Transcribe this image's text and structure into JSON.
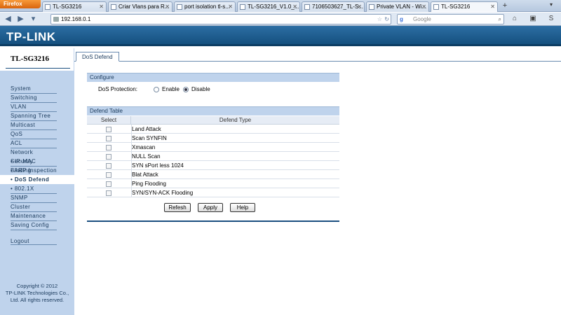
{
  "browser": {
    "app_button": "Firefox",
    "tabs": [
      {
        "title": "TL-SG3216"
      },
      {
        "title": "Criar Vlans para R..."
      },
      {
        "title": "port isolation tl-s..."
      },
      {
        "title": "TL-SG3216_V1.0_..."
      },
      {
        "title": "7106503627_TL-S..."
      },
      {
        "title": "Private VLAN - Wi..."
      },
      {
        "title": "TL-SG3216"
      }
    ],
    "url": "192.168.0.1",
    "search_engine": "Google",
    "search_placeholder": "Google"
  },
  "header": {
    "logo": "TP-LINK"
  },
  "sidebar": {
    "model": "TL-SG3216",
    "menu": [
      "System",
      "Switching",
      "VLAN",
      "Spanning Tree",
      "Multicast",
      "QoS",
      "ACL",
      "Network Security",
      "• IP-MAC Binding",
      "• ARP Inspection",
      "• DoS Defend",
      "• 802.1X",
      "SNMP",
      "Cluster",
      "Maintenance",
      "Saving Config"
    ],
    "active_item": "• DoS Defend",
    "logout": "Logout",
    "copyright": [
      "Copyright © 2012",
      "TP-LINK Technologies Co.,",
      "Ltd. All rights reserved."
    ]
  },
  "page": {
    "tab": "DoS Defend",
    "configure": {
      "title": "Configure",
      "label": "DoS Protection:",
      "options": [
        "Enable",
        "Disable"
      ],
      "selected": "Disable"
    },
    "defend_table": {
      "title": "Defend Table",
      "columns": [
        "Select",
        "Defend Type"
      ],
      "rows": [
        "Land Attack",
        "Scan SYNFIN",
        "Xmascan",
        "NULL Scan",
        "SYN sPort less 1024",
        "Blat Attack",
        "Ping Flooding",
        "SYN/SYN-ACK Flooding"
      ]
    },
    "buttons": {
      "refresh": "Refesh",
      "apply": "Apply",
      "help": "Help"
    }
  }
}
